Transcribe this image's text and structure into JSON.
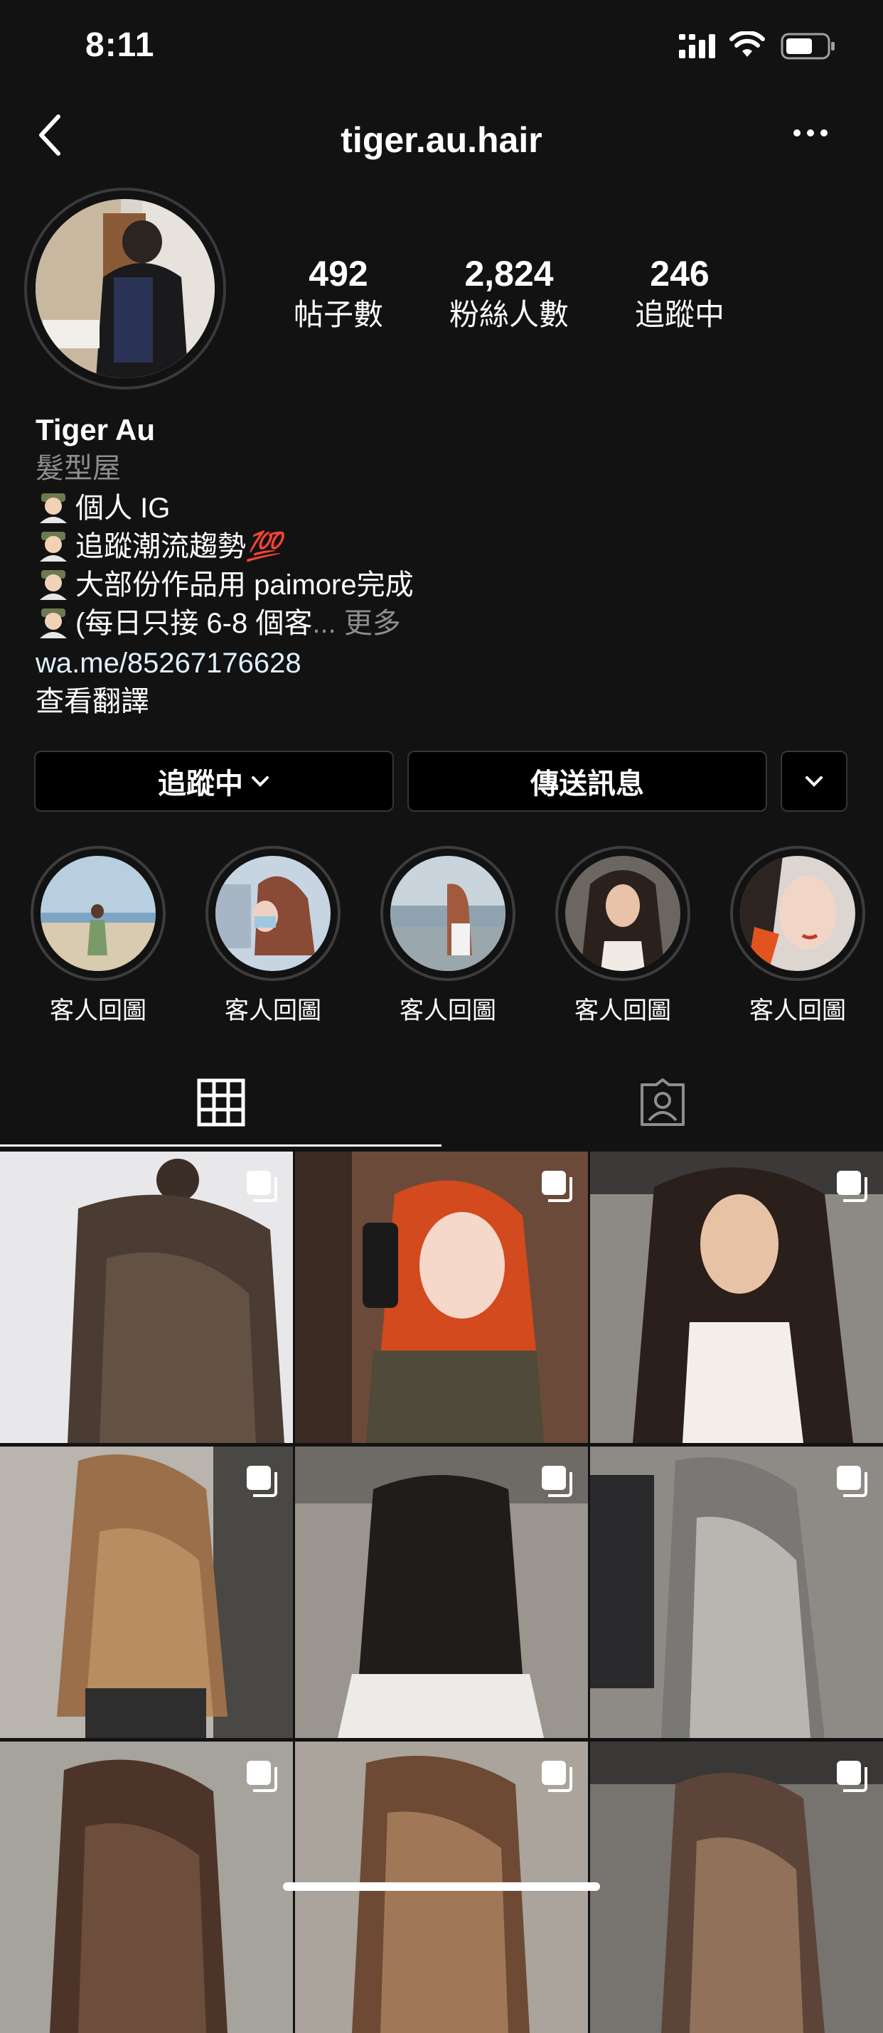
{
  "status_bar": {
    "time": "8:11"
  },
  "header": {
    "title": "tiger.au.hair"
  },
  "profile": {
    "stats": [
      {
        "value": "492",
        "label": "帖子數"
      },
      {
        "value": "2,824",
        "label": "粉絲人數"
      },
      {
        "value": "246",
        "label": "追蹤中"
      }
    ],
    "name": "Tiger Au",
    "category": "髮型屋",
    "bio_lines": [
      {
        "text": "個人 IG",
        "emoji": "man-in-cap"
      },
      {
        "text": "追蹤潮流趨勢",
        "emoji": "man-in-cap",
        "suffix": "💯"
      },
      {
        "text": "大部份作品用 paimore完成",
        "emoji": "man-in-cap"
      },
      {
        "text": "(每日只接 6-8 個客",
        "emoji": "man-in-cap",
        "more": "... 更多"
      }
    ],
    "link": "wa.me/85267176628",
    "see_translation": "查看翻譯"
  },
  "actions": {
    "following_label": "追蹤中",
    "message_label": "傳送訊息"
  },
  "highlights": [
    {
      "label": "客人回圖"
    },
    {
      "label": "客人回圖"
    },
    {
      "label": "客人回圖"
    },
    {
      "label": "客人回圖"
    },
    {
      "label": "客人回圖"
    }
  ],
  "tabs": {
    "active": "grid"
  },
  "colors": {
    "background": "#121212",
    "text": "#ffffff",
    "secondary_text": "#8e8e8e",
    "link": "#e0f1ff",
    "button_border": "#363636"
  }
}
